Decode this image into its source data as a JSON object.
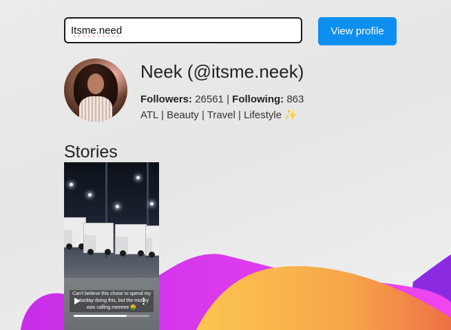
{
  "search": {
    "value": "Itsme.need"
  },
  "view_profile_label": "View profile",
  "profile": {
    "display_name": "Neek (@itsme.neek)",
    "followers_label": "Followers:",
    "followers_count": "26561",
    "separator": "|",
    "following_label": "Following:",
    "following_count": "863",
    "bio": "ATL | Beauty | Travel | Lifestyle",
    "bio_emoji": "✨"
  },
  "stories": {
    "title": "Stories",
    "items": [
      {
        "caption": "Can't believe this chose to spend my Saturday doing this, but the money was calling meeeee 🤑",
        "progress": 0.7
      }
    ]
  },
  "colors": {
    "accent": "#0d8ff0",
    "wave_magenta": "#e03df0",
    "wave_purple": "#8a2be2",
    "wave_yellow": "#f8b44a",
    "wave_orange": "#f08848"
  }
}
